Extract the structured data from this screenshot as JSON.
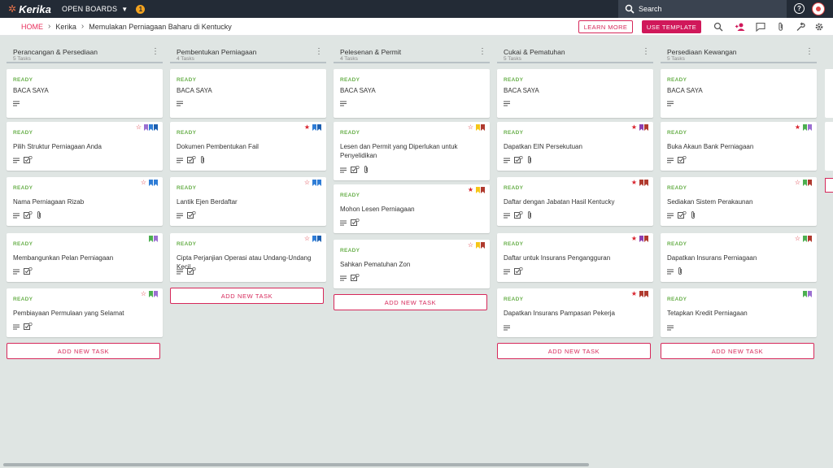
{
  "app": {
    "logo_text": "Kerika",
    "open_boards_label": "OPEN BOARDS",
    "notification_count": "1"
  },
  "search": {
    "label": "Search"
  },
  "breadcrumb": {
    "home": "HOME",
    "team": "Kerika",
    "board": "Memulakan Perniagaan Baharu di Kentucky"
  },
  "header": {
    "learn_more": "LEARN MORE",
    "use_template": "USE TEMPLATE"
  },
  "colors": {
    "accent": "#d0185a",
    "ready": "#6ab04c",
    "topbar": "#232b36",
    "background": "#dfe5e3"
  },
  "board": {
    "add_task_label": "ADD NEW TASK",
    "columns": [
      {
        "title": "Perancangan & Persediaan",
        "count": "5 Tasks",
        "cards": [
          {
            "status": "READY",
            "title": "BACA SAYA",
            "star": "",
            "flags": [],
            "icons": [
              "desc"
            ]
          },
          {
            "status": "READY",
            "title": "Pilih Struktur Perniagaan Anda",
            "star": "outline",
            "flags": [
              "#9b6fd1",
              "#2f7dd6",
              "#1c5fb0"
            ],
            "icons": [
              "desc",
              "check"
            ]
          },
          {
            "status": "READY",
            "title": "Nama Perniagaan Rizab",
            "star": "outline",
            "flags": [
              "#2f7dd6",
              "#2f7dd6"
            ],
            "icons": [
              "desc",
              "check",
              "clip"
            ]
          },
          {
            "status": "READY",
            "title": "Membangunkan Pelan Perniagaan",
            "star": "",
            "flags": [
              "#4caf50",
              "#9b6fd1"
            ],
            "icons": [
              "desc",
              "check"
            ]
          },
          {
            "status": "READY",
            "title": "Pembiayaan Permulaan yang Selamat",
            "star": "outline",
            "flags": [
              "#4caf50",
              "#9b6fd1"
            ],
            "icons": [
              "desc",
              "check"
            ]
          }
        ]
      },
      {
        "title": "Pembentukan Perniagaan",
        "count": "4 Tasks",
        "cards": [
          {
            "status": "READY",
            "title": "BACA SAYA",
            "star": "",
            "flags": [],
            "icons": [
              "desc"
            ]
          },
          {
            "status": "READY",
            "title": "Dokumen Pembentukan Fail",
            "star": "filled",
            "flags": [
              "#2f7dd6",
              "#1c5fb0"
            ],
            "icons": [
              "desc",
              "check",
              "clip"
            ]
          },
          {
            "status": "READY",
            "title": "Lantik Ejen Berdaftar",
            "star": "outline",
            "flags": [
              "#2f7dd6",
              "#2f7dd6"
            ],
            "icons": [
              "desc",
              "check"
            ]
          },
          {
            "status": "READY",
            "title": "Cipta Perjanjian Operasi atau Undang-Undang Kecil",
            "star": "outline",
            "flags": [
              "#2f7dd6",
              "#1c5fb0"
            ],
            "icons": [
              "desc",
              "check"
            ]
          }
        ]
      },
      {
        "title": "Pelesenan & Permit",
        "count": "4 Tasks",
        "cards": [
          {
            "status": "READY",
            "title": "BACA SAYA",
            "star": "",
            "flags": [],
            "icons": [
              "desc"
            ]
          },
          {
            "status": "READY",
            "title": "Lesen dan Permit yang Diperlukan untuk Penyelidikan",
            "star": "outline",
            "flags": [
              "#f5c518",
              "#b03a2e"
            ],
            "icons": [
              "desc",
              "check",
              "clip"
            ]
          },
          {
            "status": "READY",
            "title": "Mohon Lesen Perniagaan",
            "star": "filled",
            "flags": [
              "#f5c518",
              "#b03a2e"
            ],
            "icons": [
              "desc",
              "check"
            ]
          },
          {
            "status": "READY",
            "title": "Sahkan Pematuhan Zon",
            "star": "outline",
            "flags": [
              "#f5c518",
              "#b03a2e"
            ],
            "icons": [
              "desc",
              "check"
            ]
          }
        ]
      },
      {
        "title": "Cukai & Pematuhan",
        "count": "5 Tasks",
        "cards": [
          {
            "status": "READY",
            "title": "BACA SAYA",
            "star": "",
            "flags": [],
            "icons": [
              "desc"
            ]
          },
          {
            "status": "READY",
            "title": "Dapatkan EIN Persekutuan",
            "star": "filled",
            "flags": [
              "#8e3fb0",
              "#b03a2e"
            ],
            "icons": [
              "desc",
              "check",
              "clip"
            ]
          },
          {
            "status": "READY",
            "title": "Daftar dengan Jabatan Hasil Kentucky",
            "star": "filled",
            "flags": [
              "#b03a2e",
              "#b03a2e"
            ],
            "icons": [
              "desc",
              "check",
              "clip"
            ]
          },
          {
            "status": "READY",
            "title": "Daftar untuk Insurans Pengangguran",
            "star": "filled",
            "flags": [
              "#8e3fb0",
              "#b03a2e"
            ],
            "icons": [
              "desc",
              "check"
            ]
          },
          {
            "status": "READY",
            "title": "Dapatkan Insurans Pampasan Pekerja",
            "star": "filled",
            "flags": [
              "#b03a2e",
              "#b03a2e"
            ],
            "icons": [
              "desc"
            ]
          }
        ]
      },
      {
        "title": "Persediaan Kewangan",
        "count": "5 Tasks",
        "cards": [
          {
            "status": "READY",
            "title": "BACA SAYA",
            "star": "",
            "flags": [],
            "icons": [
              "desc"
            ]
          },
          {
            "status": "READY",
            "title": "Buka Akaun Bank Perniagaan",
            "star": "filled",
            "flags": [
              "#4caf50",
              "#9b6fd1"
            ],
            "icons": [
              "desc",
              "check"
            ]
          },
          {
            "status": "READY",
            "title": "Sediakan Sistem Perakaunan",
            "star": "outline",
            "flags": [
              "#4caf50",
              "#b03a2e"
            ],
            "icons": [
              "desc",
              "check",
              "clip"
            ]
          },
          {
            "status": "READY",
            "title": "Dapatkan Insurans Perniagaan",
            "star": "outline",
            "flags": [
              "#4caf50",
              "#b03a2e"
            ],
            "icons": [
              "desc",
              "clip"
            ]
          },
          {
            "status": "READY",
            "title": "Tetapkan Kredit Perniagaan",
            "star": "",
            "flags": [
              "#4caf50",
              "#9b6fd1"
            ],
            "icons": [
              "desc"
            ]
          }
        ]
      }
    ]
  }
}
